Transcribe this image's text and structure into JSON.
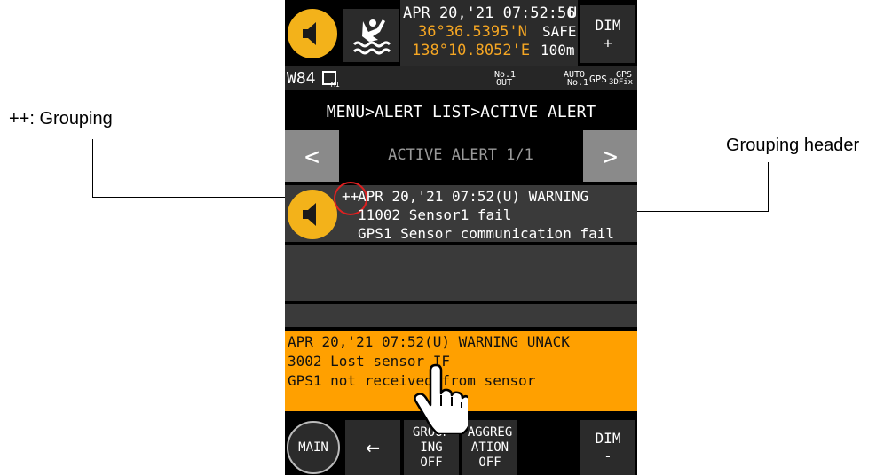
{
  "annotations": {
    "left_label": "++: Grouping",
    "right_label": "Grouping header"
  },
  "header": {
    "date_time": "APR 20,'21 07:52:56",
    "time_mode": "U",
    "latitude": "36°36.5395'N",
    "longitude": "138°10.8052'E",
    "safety": "SAFE",
    "depth": "100m",
    "dim_label": "DIM",
    "dim_plus": "+"
  },
  "status_bar": {
    "waypoint": "W84",
    "m1": "M1",
    "no1_top": "No.1",
    "no1_bottom": "OUT",
    "auto_top": "AUTO",
    "auto_bottom": "No.1",
    "gps": "GPS",
    "gps_fix_top": "GPS",
    "gps_fix_bottom": "3DFix"
  },
  "breadcrumb": "MENU>ALERT LIST>ACTIVE ALERT",
  "pager": {
    "prev": "<",
    "next": ">",
    "title": "ACTIVE ALERT 1/1"
  },
  "alert_group": {
    "prefix": "++",
    "line1": "APR 20,'21 07:52(U) WARNING",
    "line2": "11002 Sensor1 fail",
    "line3": "GPS1 Sensor communication fail"
  },
  "alert_unack": {
    "line1": "APR 20,'21 07:52(U) WARNING UNACK",
    "line2": "3002  Lost sensor IF",
    "line3": "GPS1 not received from sensor"
  },
  "footer": {
    "main": "MAIN",
    "back_arrow": "←",
    "grouping_l1": "GROUP",
    "grouping_l2": "ING",
    "grouping_l3": "OFF",
    "aggregation_l1": "AGGREG",
    "aggregation_l2": "ATION",
    "aggregation_l3": "OFF",
    "dim_label": "DIM",
    "dim_minus": "-"
  },
  "colors": {
    "accent_yellow": "#f3b21a",
    "warning_orange": "#ffa000",
    "header_orange": "#f5a623",
    "annotation_red": "#e02020"
  },
  "icons": [
    "speaker-icon",
    "person-overboard-icon",
    "m1-icon",
    "hand-pointer-icon",
    "arrow-left-icon"
  ]
}
